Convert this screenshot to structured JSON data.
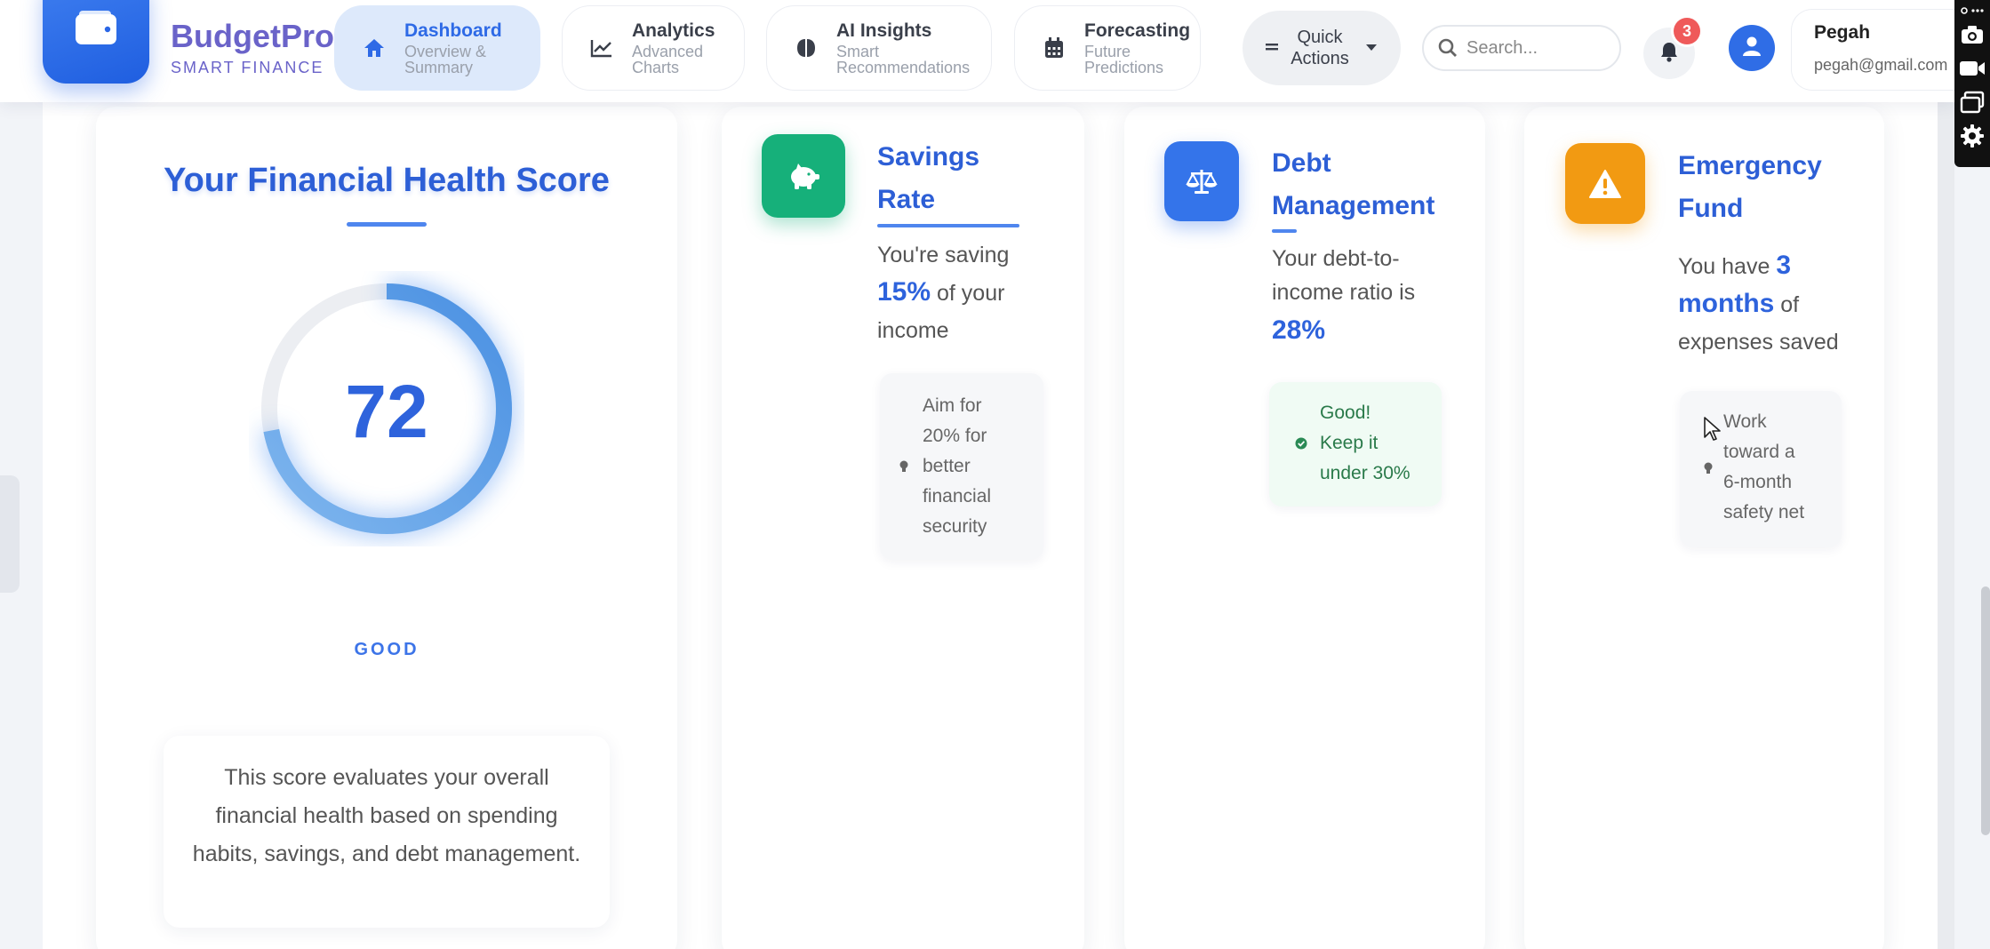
{
  "brand": {
    "name": "BudgetPro",
    "tagline": "SMART FINANCE"
  },
  "nav": [
    {
      "title": "Dashboard",
      "subtitle": "Overview &\nSummary",
      "icon": "home-icon",
      "active": true
    },
    {
      "title": "Analytics",
      "subtitle": "Advanced\nCharts",
      "icon": "line-chart-icon",
      "active": false
    },
    {
      "title": "AI Insights",
      "subtitle": "Smart\nRecommendations",
      "icon": "brain-icon",
      "active": false
    },
    {
      "title": "Forecasting",
      "subtitle": "Future\nPredictions",
      "icon": "calendar-icon",
      "active": false
    }
  ],
  "quick_actions": {
    "label": "Quick\nActions"
  },
  "search": {
    "placeholder": "Search..."
  },
  "notifications": {
    "count": "3"
  },
  "user": {
    "name": "Pegah",
    "email": "pegah@gmail.com"
  },
  "health": {
    "title": "Your Financial Health Score",
    "score": "72",
    "score_fraction": 0.72,
    "status": "GOOD",
    "description": "This score evaluates your overall financial health based on spending habits, savings, and debt management."
  },
  "savings": {
    "title": "Savings\nRate",
    "text_before": "You're saving",
    "value": "15%",
    "text_after": "of your income",
    "tip": "Aim for\n20% for\nbetter\nfinancial\nsecurity"
  },
  "debt": {
    "title": "Debt\nManagement",
    "text_before": "Your debt-to-income ratio is",
    "value": "28%",
    "tip": "Good!\nKeep it\nunder 30%"
  },
  "emergency": {
    "title": "Emergency\nFund",
    "text_before": "You have",
    "value": "3 months",
    "text_after": "of expenses saved",
    "tip": "Work\ntoward a\n6-month\nsafety net"
  },
  "colors": {
    "primary": "#2e63dc",
    "savings_icon": "#16b07a",
    "debt_icon": "#3474ea",
    "emergency_icon": "#f29a12",
    "badge": "#ef5a5a"
  }
}
